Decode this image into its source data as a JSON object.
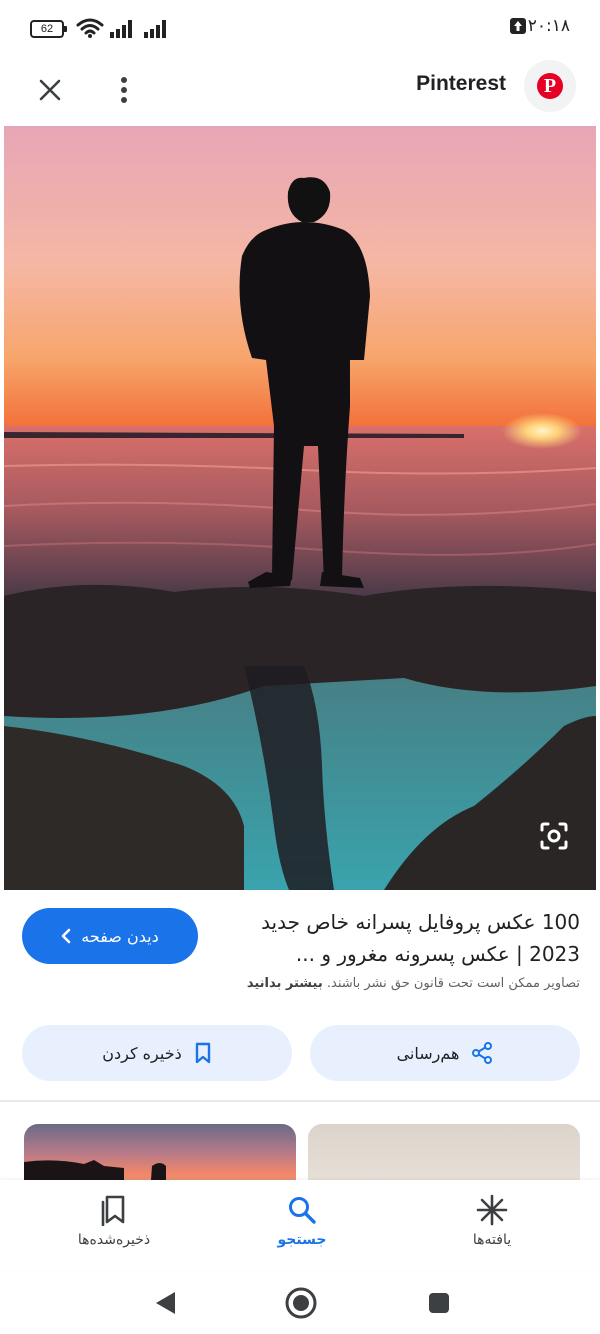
{
  "status_bar": {
    "time": "۲۰:۱۸",
    "battery_level": "62"
  },
  "header": {
    "source_name": "Pinterest",
    "logo_letter": "P"
  },
  "result": {
    "title": "100 عکس پروفایل پسرانه خاص جدید 2023 | عکس پسرونه مغرور و ...",
    "copyright_notice": "تصاویر ممکن است تحت قانون حق نشر باشند.",
    "learn_more": "بیشتر بدانید",
    "visit_label": "دیدن صفحه"
  },
  "actions": {
    "share_label": "هم‌رسانی",
    "save_label": "ذخیره کردن"
  },
  "bottom_nav": {
    "items": [
      {
        "label": "یافته‌ها",
        "icon": "asterisk-icon"
      },
      {
        "label": "جستجو",
        "icon": "search-icon",
        "active": true
      },
      {
        "label": "ذخیره‌شده‌ها",
        "icon": "bookmarks-icon"
      }
    ]
  },
  "colors": {
    "accent": "#1a73e8",
    "tonal_button": "#e8f0fe",
    "pinterest_red": "#e60023"
  }
}
